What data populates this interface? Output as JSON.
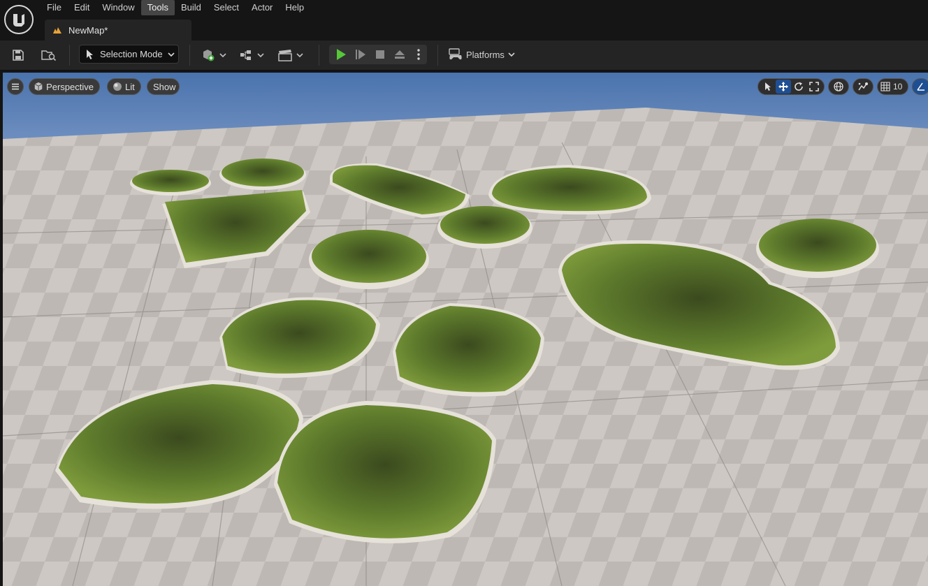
{
  "menu": {
    "items": [
      {
        "label": "File"
      },
      {
        "label": "Edit"
      },
      {
        "label": "Window"
      },
      {
        "label": "Tools"
      },
      {
        "label": "Build"
      },
      {
        "label": "Select"
      },
      {
        "label": "Actor"
      },
      {
        "label": "Help"
      }
    ],
    "active_index": 3
  },
  "document_tab": {
    "label": "NewMap*",
    "icon": "level-icon"
  },
  "toolbar": {
    "mode_label": "Selection Mode",
    "platforms_label": "Platforms"
  },
  "viewport": {
    "perspective_label": "Perspective",
    "lit_label": "Lit",
    "show_label": "Show",
    "grid_size": "10"
  },
  "colors": {
    "accent": "#1f4f92",
    "play_green": "#57c73a",
    "sky": "#4f78b0",
    "floor": "#c9c4bf"
  }
}
